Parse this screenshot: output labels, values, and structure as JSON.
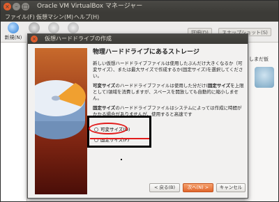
{
  "app": {
    "window_title": "Oracle VM VirtualBox マネージャー"
  },
  "menubar": {
    "items": [
      "ファイル(F)",
      "仮想マシン(M)",
      "ヘルプ(H)"
    ]
  },
  "toolbar": {
    "new_label": "新規(N)",
    "right_tabs": [
      "詳細(D)",
      "スナップショット(S)"
    ]
  },
  "details_panel": {
    "text": "しまだ仮"
  },
  "dialog": {
    "title": "仮想ハードドライブの作成",
    "heading": "物理ハードドライブにあるストレージ",
    "para1": "新しい仮想ハードドライブファイルは使用したぶんだけ大きくなるか（可変サイズ）、または最大サイズで作成するか(固定サイズ)を選択してください。",
    "para2_bold": "可変サイズ",
    "para2_rest": "のハードドライブファイルは使用した分だけ(",
    "para2_bold2": "固定サイズ",
    "para2_rest2": "を上限として)領域を消費しますが、スペースを開放しても自動的に縮小しません。",
    "para3_bold": "固定サイズ",
    "para3_rest": "のハードドライブファイルはシステムによっては作成に時間がかかる場合がありませんが、使用すると高速です",
    "option_dynamic": "可変サイズ(D)",
    "option_fixed": "固定サイズ(F)",
    "buttons": {
      "back": "< 戻る(B)",
      "next": "次へ(N) >",
      "cancel": "キャンセル"
    }
  },
  "colors": {
    "titlebar": "#3c3b37",
    "accent": "#e0662c",
    "annotation_red": "#e21b1b"
  }
}
